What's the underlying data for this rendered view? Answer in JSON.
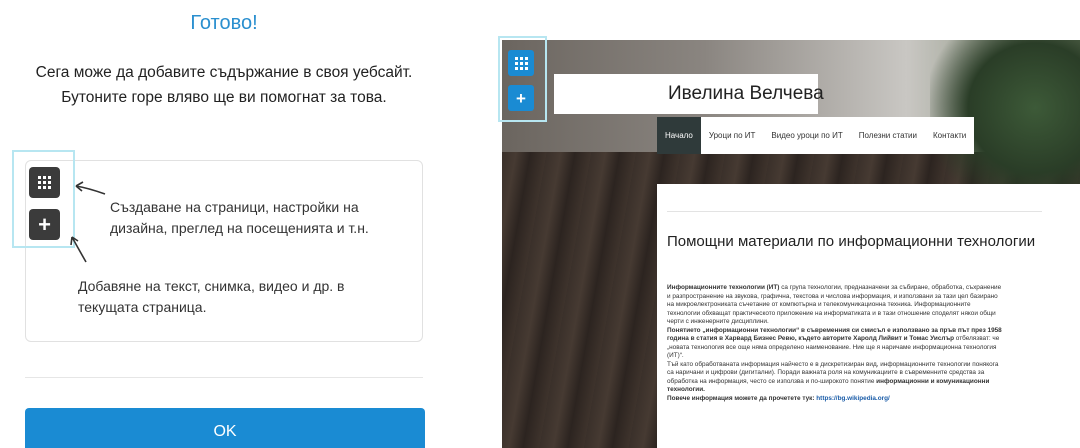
{
  "dialog": {
    "title": "Готово!",
    "intro_line1": "Сега може да добавите съдържание в своя уебсайт.",
    "intro_line2": "Бутоните горе вляво ще ви помогнат за това.",
    "grid_icon": "grid-icon",
    "plus_icon": "plus-icon",
    "desc_pages_line1": "Създаване на страници, настройки на",
    "desc_pages_line2": "дизайна, преглед на посещенията и т.н.",
    "desc_add_line1": "Добавяне на текст, снимка, видео и др. в",
    "desc_add_line2": "текущата страница.",
    "ok_label": "OK",
    "accent_color": "#1a8bd3",
    "highlight_color": "#b7e6f1"
  },
  "preview": {
    "site_title": "Ивелина Велчева",
    "nav": [
      "Начало",
      "Уроци по ИТ",
      "Видео уроци по ИТ",
      "Полезни статии",
      "Контакти"
    ],
    "content_title": "Помощни материали по информационни технологии",
    "para1_bold": "Информационните технологии (ИТ)",
    "para1_line1": " са група технологии, предназначени за събиране, обработка, съхранение",
    "para1_line2": "и разпространение на звукова, графична, текстова и числова информация, и използвани за тази цел базирано",
    "para1_line3": "на микроелектрониката съчетание от компютърна и телекомуникационна техника. Информационните",
    "para1_line4": "технологии обхващат практическото приложение на информатиката и в тази отношение споделят някои общи",
    "para1_line5": "черти с инженерните дисциплини.",
    "para2_bold_a": "Понятието „информационни технологии“ в съвременния си смисъл е използвано за пръв път през 1958",
    "para2_bold_b": "година в статия в Харвард Бизнес Ревю, където авторите Харолд Лийвит и Томас Уислър",
    "para2_tail": " отбелязват: че",
    "para2_line3": "„новата технология все още няма определено наименование. Ние ще я наричаме информационна технология",
    "para2_line4": "(ИТ)“.",
    "para3_line1": "Тъй като обработваната информация найчесто е в дискретизиран вид, информационните технологии понякога",
    "para3_line2": "са наричани и цифрови (дигитални). Поради важната роля на комуникациите в съвременните средства за",
    "para3_line3": "обработка на информация, често се използва и по-широкото понятие",
    "para3_bold": " информационни и комуникационни",
    "para3_line4": "технологии.",
    "more_label": "Повече информация можете да прочетете тук: ",
    "more_link": "https://bg.wikipedia.org/"
  }
}
